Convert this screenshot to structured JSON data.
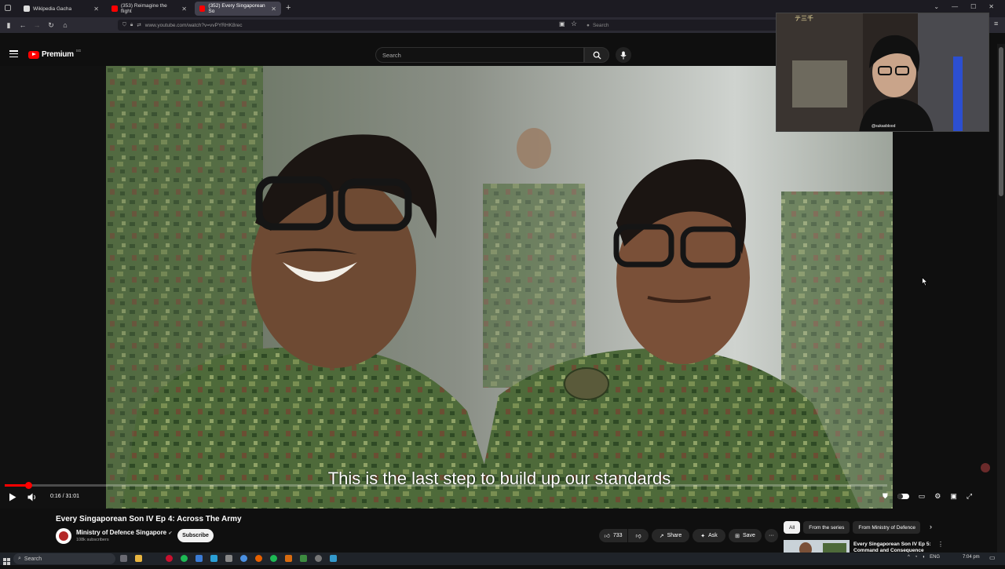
{
  "browser": {
    "tabs": [
      {
        "label": "Wikipedia Gacha",
        "active": false
      },
      {
        "label": "(353) Reimagine the flight",
        "active": false
      },
      {
        "label": "(352) Every Singaporean So",
        "active": true
      }
    ],
    "new_tab": "+",
    "url": "www.youtube.com/watch?v=vvPYRHK8rec",
    "search_placeholder": "Search"
  },
  "youtube": {
    "logo_text": "Premium",
    "logo_region": "SG",
    "search_placeholder": "Search"
  },
  "player": {
    "subtitle": "This is the last step to build up our standards",
    "current_time": "0:16",
    "duration": "31:01",
    "time_display": "0:16 / 31:01",
    "progress_fraction": 0.0086
  },
  "video": {
    "title": "Every Singaporean Son IV Ep 4: Across The Army",
    "channel": "Ministry of Defence Singapore",
    "subscribers": "108k subscribers",
    "subscribe_label": "Subscribe",
    "likes": "733",
    "share_label": "Share",
    "ask_label": "Ask",
    "save_label": "Save",
    "more": "···"
  },
  "recommendations": {
    "chips": [
      "All",
      "From the series",
      "From Ministry of Defence"
    ],
    "first_title": "Every Singaporean Son IV Ep 5: Command and Consequence"
  },
  "webcam": {
    "handle": "@sukasblood",
    "sign": "テ三千"
  },
  "taskbar": {
    "search_label": "Search",
    "lang": "ENG",
    "time": "7:04 pm"
  },
  "colors": {
    "yt_red": "#ff0000",
    "background": "#0f0f0f",
    "camo_green": "#4e6a3a"
  }
}
